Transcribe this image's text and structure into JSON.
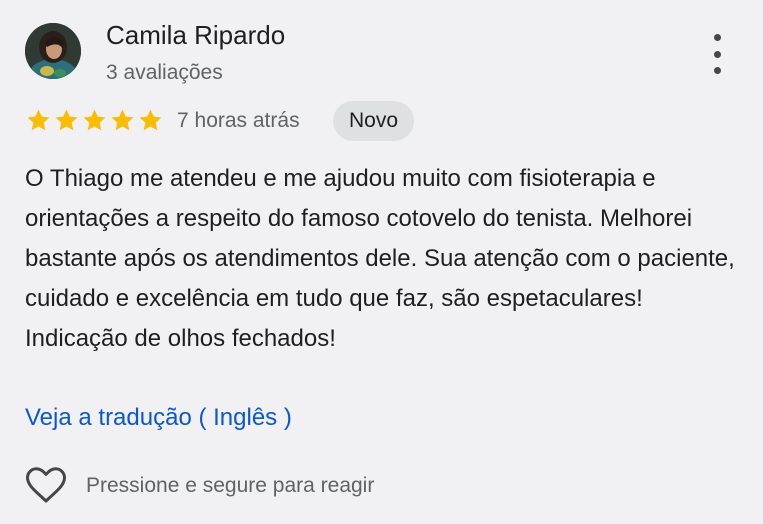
{
  "review": {
    "author_name": "Camila Ripardo",
    "author_reviews": "3 avaliações",
    "rating": 5,
    "rating_max": 5,
    "time_ago": "7 horas atrás",
    "badge": "Novo",
    "text": "O Thiago me atendeu e me ajudou muito com fisioterapia e orientações a respeito do famoso cotovelo do tenista. Melhorei bastante após os atendimentos dele. Sua atenção com o paciente, cuidado e excelência em tudo que faz, são espetaculares! Indicação de olhos fechados!",
    "translate_link": "Veja a tradução ( Inglês )",
    "react_hint": "Pressione e segure para reagir"
  },
  "icons": {
    "menu": "more-vert-icon",
    "star": "star-icon",
    "react": "heart-outline-icon",
    "avatar": "avatar"
  },
  "colors": {
    "background": "#f1f1f4",
    "star": "#fbbc04",
    "link": "#0b57d0",
    "secondary_text": "#5f6368",
    "badge_bg": "#dfe0e4"
  }
}
